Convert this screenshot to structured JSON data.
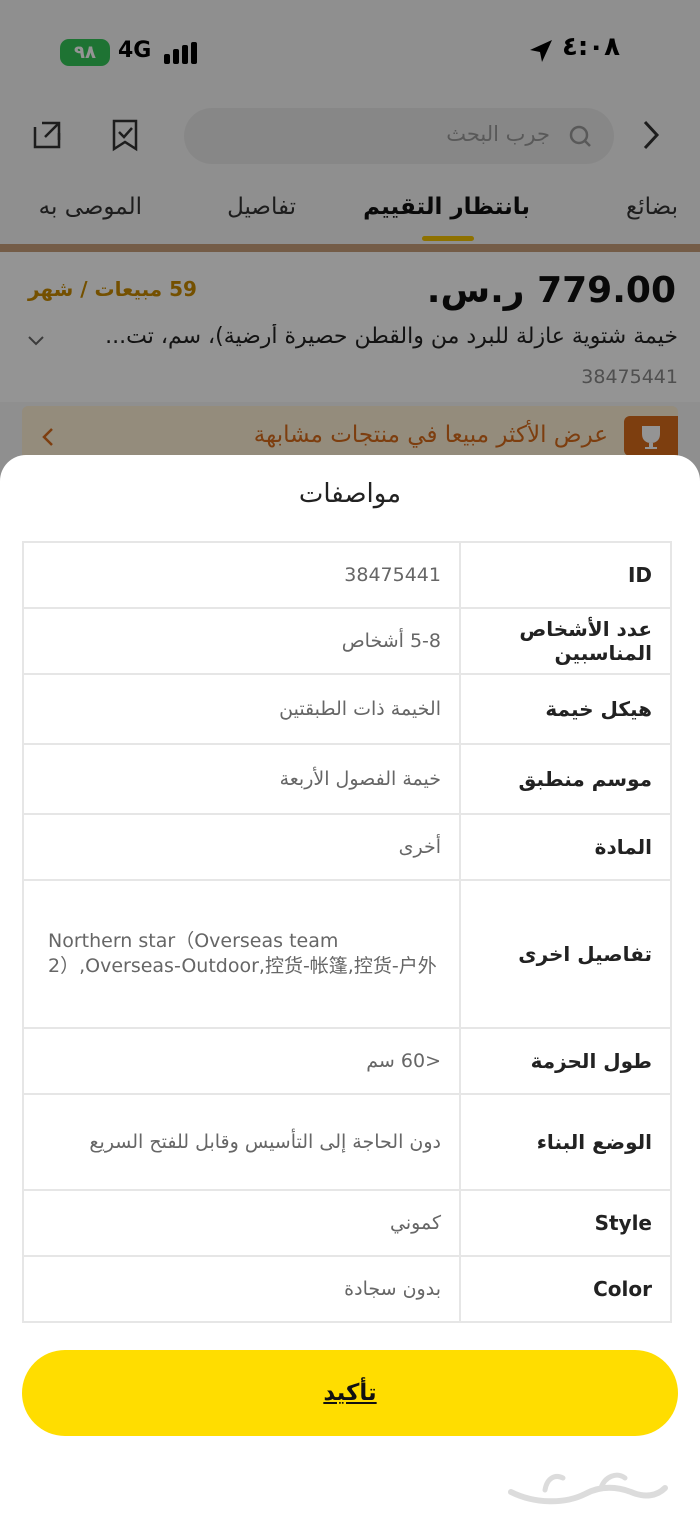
{
  "status_bar": {
    "battery": "٩٨",
    "network": "4G",
    "time": "٤:٠٨"
  },
  "search": {
    "placeholder": "جرب البحث"
  },
  "tabs": [
    {
      "label": "بضائع"
    },
    {
      "label": "بانتظار التقييم"
    },
    {
      "label": "تفاصيل"
    },
    {
      "label": "الموصى به"
    }
  ],
  "product": {
    "price": "779.00 ر.س.",
    "monthly_sales": "59 مبيعات / شهر",
    "title": "خيمة شتوية عازلة للبرد من والقطن حصيرة أرضية)، سم، تت...",
    "id": "38475441"
  },
  "promo": {
    "text": "عرض الأكثر مبيعا في منتجات مشابهة"
  },
  "sheet": {
    "title": "مواصفات",
    "confirm_label": "تأكيد",
    "specs": [
      {
        "key": "ID",
        "value": "38475441"
      },
      {
        "key": "عدد الأشخاص المناسبين",
        "value": "5-8 أشخاص"
      },
      {
        "key": "هيكل خيمة",
        "value": "الخيمة ذات الطبقتين"
      },
      {
        "key": "موسم منطبق",
        "value": "خيمة الفصول الأربعة"
      },
      {
        "key": "المادة",
        "value": "أخرى"
      },
      {
        "key": "تفاصيل اخرى",
        "value": "Northern star（Overseas team 2）,Overseas-Outdoor,控货-帐篷,控货-户外"
      },
      {
        "key": "طول الحزمة",
        "value": "<60 سم"
      },
      {
        "key": "الوضع البناء",
        "value": "دون الحاجة إلى التأسيس وقابل للفتح السريع"
      },
      {
        "key": "Style",
        "value": "كموني"
      },
      {
        "key": "Color",
        "value": "بدون سجادة"
      }
    ]
  },
  "colors": {
    "accent": "#ffdd00",
    "promo": "#d86b1a",
    "sales": "#c98a00",
    "battery": "#34c759"
  },
  "icons": [
    "battery-icon",
    "signal-icon",
    "location-arrow-icon",
    "share-icon",
    "bookmark-icon",
    "search-icon",
    "back-chevron-icon",
    "trophy-icon"
  ]
}
